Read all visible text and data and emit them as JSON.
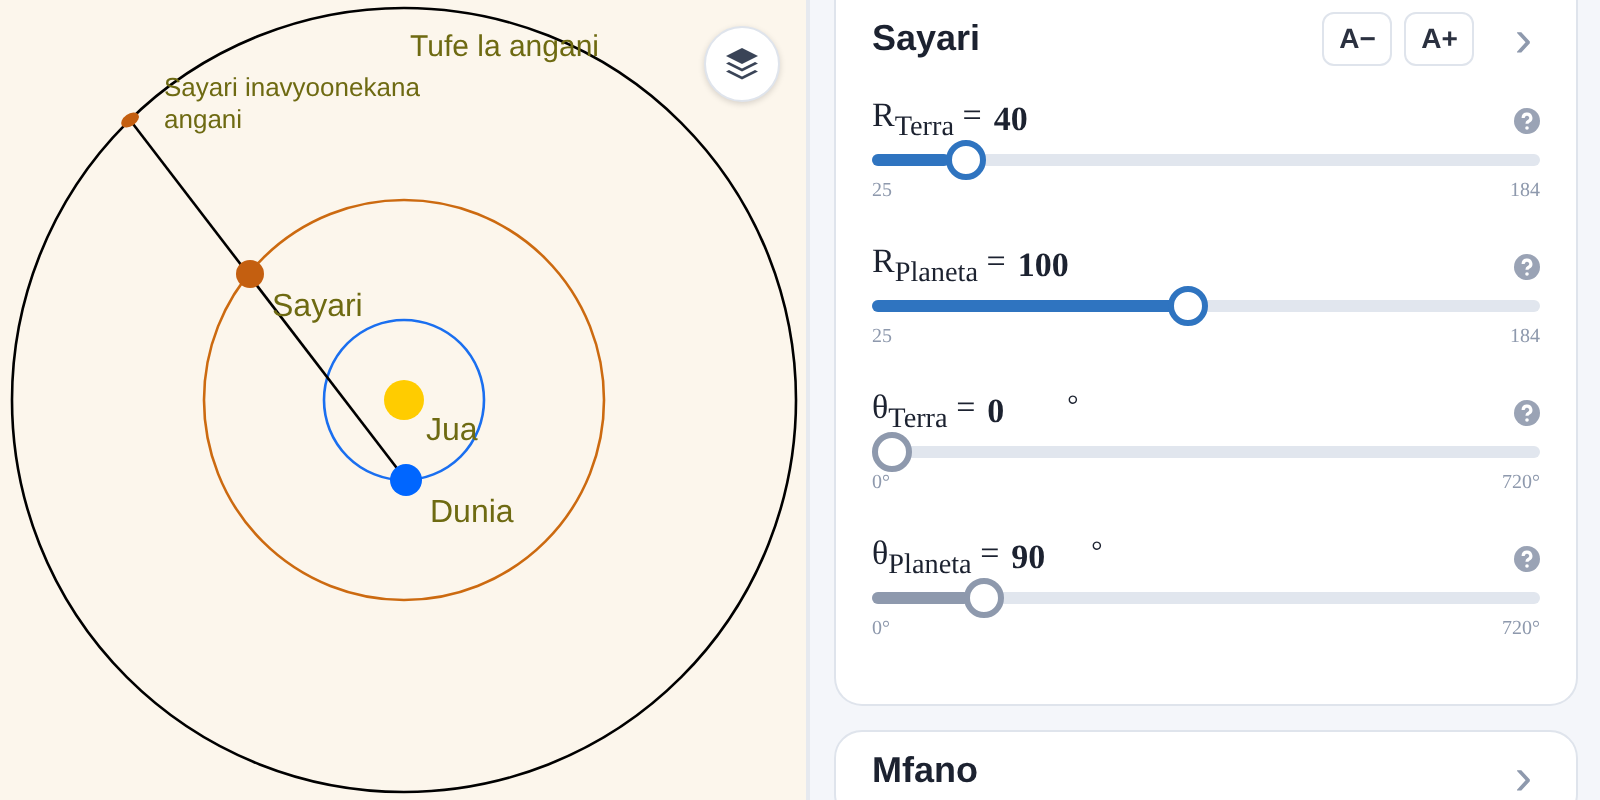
{
  "canvas": {
    "labels": [
      {
        "kind": "sphere",
        "text": "Tufe la angani"
      },
      {
        "kind": "apparent",
        "text": "Sayari inavyoonekana angani"
      },
      {
        "kind": "planet",
        "text": "Sayari"
      },
      {
        "kind": "sun",
        "text": "Jua"
      },
      {
        "kind": "earth",
        "text": "Dunia"
      }
    ]
  },
  "panel": {
    "title": "Sayari",
    "buttons": [
      "A−",
      "A+"
    ],
    "collapse": "›",
    "sliders": [
      {
        "label": "R$_{Terra}$ =",
        "value": "40",
        "level": 0.117,
        "min": "25",
        "max": "184",
        "color": "#2f74c0"
      },
      {
        "label": "R$_{Planeta}$ =",
        "value": "100",
        "level": 0.47,
        "min": "25",
        "max": "184",
        "color": "#2f74c0"
      },
      {
        "label": "θ$_{Terra}$ =",
        "value": "0",
        "unit": "°",
        "level": 0,
        "min": "0°",
        "max": "720°",
        "color": "#8e99ad"
      },
      {
        "label": "θ$_{Planeta}$ =",
        "value": "90",
        "unit": "°",
        "level": 0.146,
        "min": "0°",
        "max": "720°",
        "color": "#8e99ad"
      }
    ]
  },
  "next_card": {
    "title": "Mfano",
    "collapse": "›"
  }
}
